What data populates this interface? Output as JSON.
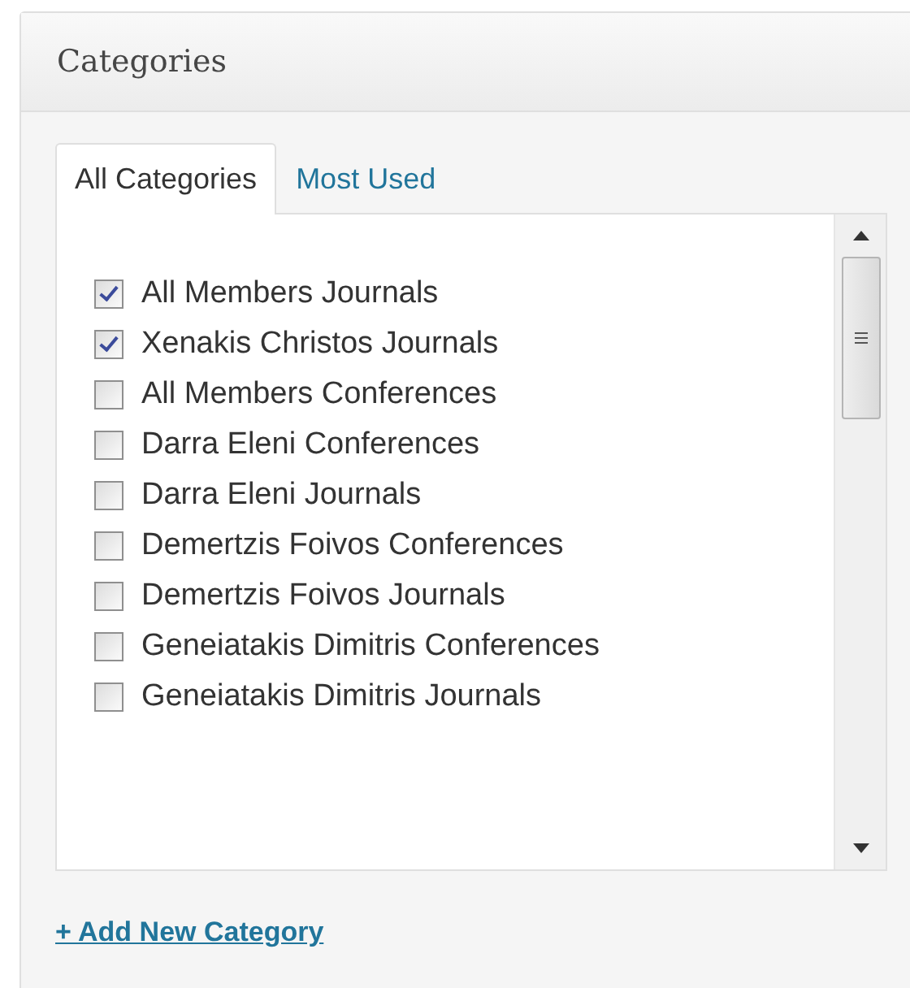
{
  "panel": {
    "title": "Categories"
  },
  "tabs": [
    {
      "label": "All Categories",
      "selected": true
    },
    {
      "label": "Most Used",
      "selected": false
    }
  ],
  "categories": [
    {
      "label": "All Members Journals",
      "checked": true
    },
    {
      "label": "Xenakis Christos Journals",
      "checked": true
    },
    {
      "label": "All Members Conferences",
      "checked": false
    },
    {
      "label": "Darra Eleni Conferences",
      "checked": false
    },
    {
      "label": "Darra Eleni Journals",
      "checked": false
    },
    {
      "label": "Demertzis Foivos Conferences",
      "checked": false
    },
    {
      "label": "Demertzis Foivos Journals",
      "checked": false
    },
    {
      "label": "Geneiatakis Dimitris Conferences",
      "checked": false
    },
    {
      "label": "Geneiatakis Dimitris Journals",
      "checked": false
    }
  ],
  "add_link": "+ Add New Category"
}
